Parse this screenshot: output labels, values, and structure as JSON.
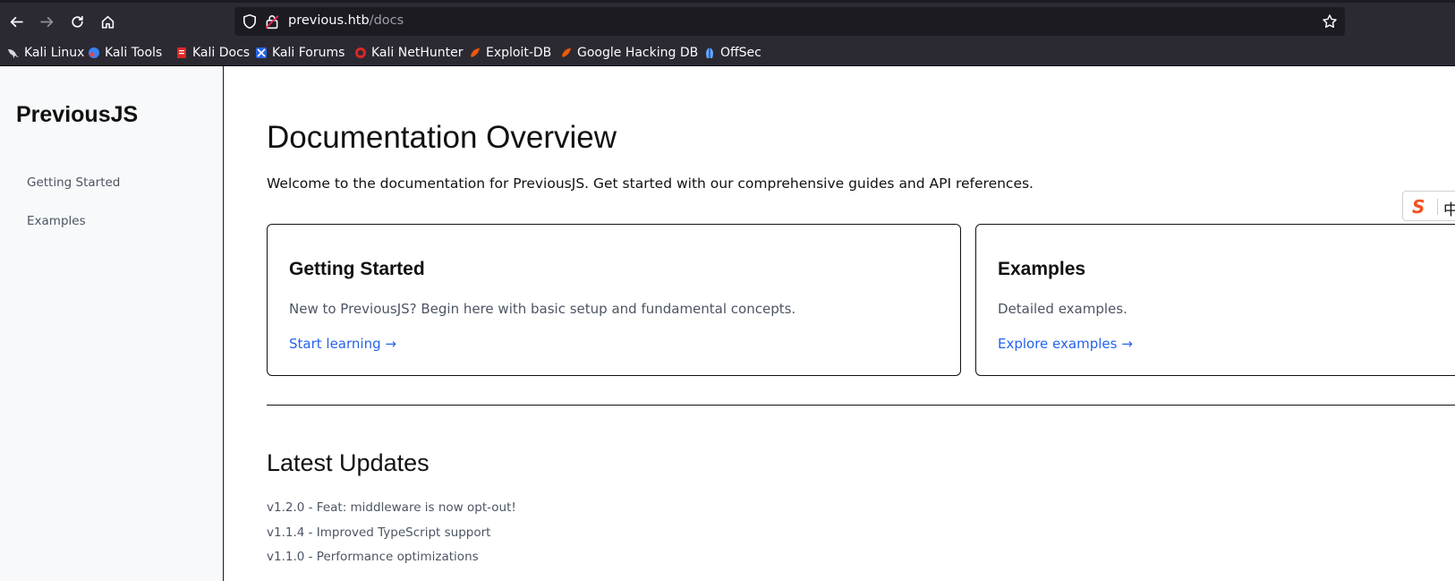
{
  "browser": {
    "url_host": "previous.htb",
    "url_path": "/docs",
    "bookmarks": [
      {
        "label": "Kali Linux",
        "icon": "kali-dragon-icon"
      },
      {
        "label": "Kali Tools",
        "icon": "kali-tools-icon"
      },
      {
        "label": "Kali Docs",
        "icon": "kali-docs-icon"
      },
      {
        "label": "Kali Forums",
        "icon": "kali-forums-icon"
      },
      {
        "label": "Kali NetHunter",
        "icon": "kali-nethunter-icon"
      },
      {
        "label": "Exploit-DB",
        "icon": "exploit-db-icon"
      },
      {
        "label": "Google Hacking DB",
        "icon": "ghdb-icon"
      },
      {
        "label": "OffSec",
        "icon": "offsec-icon"
      }
    ]
  },
  "sidebar": {
    "brand": "PreviousJS",
    "items": [
      {
        "label": "Getting Started"
      },
      {
        "label": "Examples"
      }
    ]
  },
  "main": {
    "title": "Documentation Overview",
    "lead": "Welcome to the documentation for PreviousJS. Get started with our comprehensive guides and API references.",
    "cards": [
      {
        "title": "Getting Started",
        "desc": "New to PreviousJS? Begin here with basic setup and fundamental concepts.",
        "link": "Start learning →"
      },
      {
        "title": "Examples",
        "desc": "Detailed examples.",
        "link": "Explore examples →"
      }
    ],
    "updates_title": "Latest Updates",
    "updates": [
      "v1.2.0 - Feat: middleware is now opt-out!",
      "v1.1.4 - Improved TypeScript support",
      "v1.1.0 - Performance optimizations"
    ]
  },
  "ime": {
    "logo": "S",
    "mode": "中"
  },
  "colors": {
    "link": "#2563eb",
    "chrome": "#2b2a33",
    "urlbar": "#1c1b22"
  }
}
